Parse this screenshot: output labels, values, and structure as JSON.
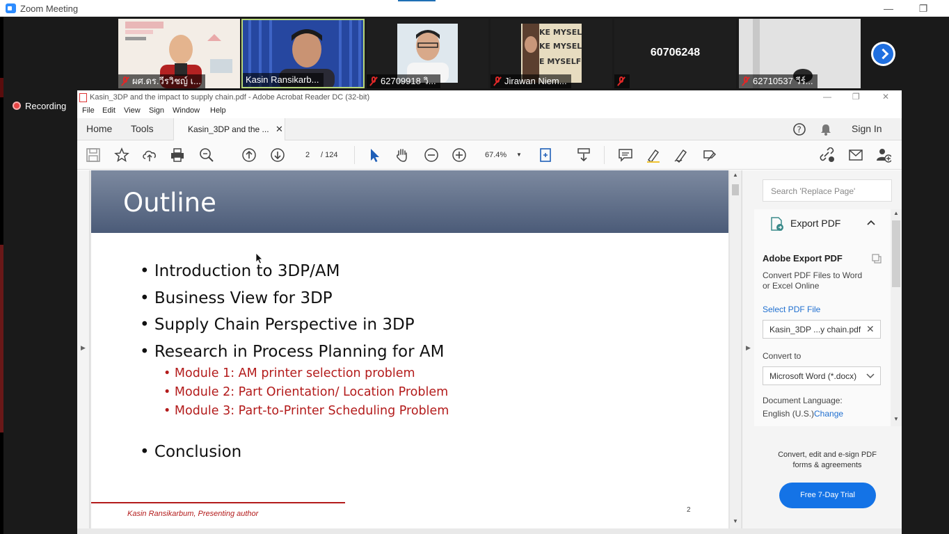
{
  "zoom": {
    "title": "Zoom Meeting",
    "recording_label": "Recording",
    "participants": [
      {
        "name": "ผศ.ดร.วีรวิชญ์ เ..."
      },
      {
        "name": "Kasin Ransikarb..."
      },
      {
        "name": "62709918   วิ..."
      },
      {
        "name": "Jirawan Niem..."
      },
      {
        "name": "60706248"
      },
      {
        "name": "62710537 วีร์..."
      }
    ]
  },
  "acrobat": {
    "title": "Kasin_3DP and the impact to supply chain.pdf - Adobe Acrobat Reader DC (32-bit)",
    "menu": [
      "File",
      "Edit",
      "View",
      "Sign",
      "Window",
      "Help"
    ],
    "nav": {
      "home": "Home",
      "tools": "Tools"
    },
    "doc_tab": "Kasin_3DP and the ...",
    "sign_in": "Sign In",
    "page_current": "2",
    "page_total": "/   124",
    "zoom_level": "67.4%"
  },
  "slide": {
    "title": "Outline",
    "bullets": [
      "Introduction to 3DP/AM",
      "Business View for 3DP",
      "Supply Chain Perspective in 3DP",
      "Research in Process Planning for AM"
    ],
    "sub_bullets": [
      "Module 1: AM printer selection problem",
      "Module 2: Part Orientation/ Location Problem",
      "Module 3: Part-to-Printer Scheduling Problem"
    ],
    "conclusion": "Conclusion",
    "footer": "Kasin Ransikarbum, Presenting author",
    "page_number": "2"
  },
  "right_pane": {
    "search_placeholder": "Search 'Replace Page'",
    "export_header": "Export PDF",
    "service_title": "Adobe Export PDF",
    "service_desc_1": "Convert PDF Files to Word",
    "service_desc_2": "or Excel Online",
    "select_file_link": "Select PDF File",
    "selected_file": "Kasin_3DP ...y chain.pdf",
    "convert_to_label": "Convert to",
    "convert_format": "Microsoft Word (*.docx)",
    "doc_language_label": "Document Language:",
    "doc_language_value": "English (U.S.)",
    "change_link": "Change",
    "promo_1": "Convert, edit and e-sign PDF",
    "promo_2": "forms & agreements",
    "trial_button": "Free 7-Day Trial"
  }
}
